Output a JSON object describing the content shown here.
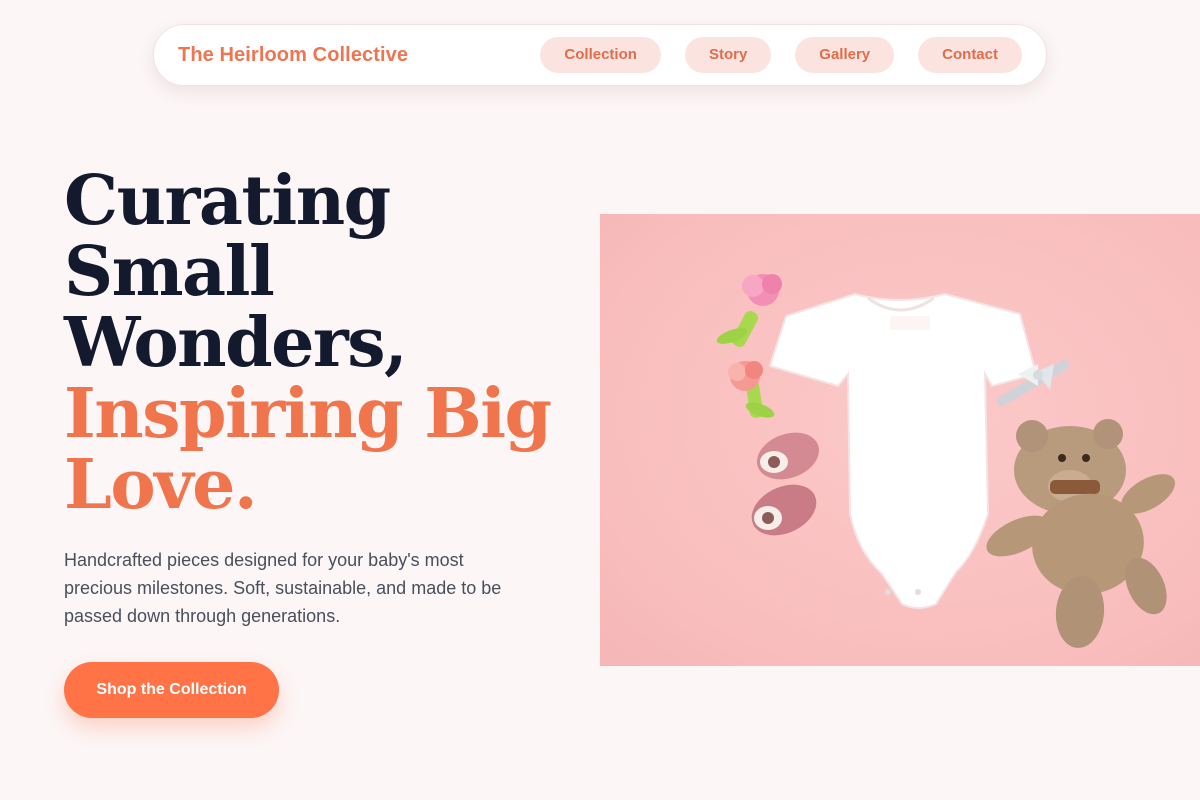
{
  "nav": {
    "brand": "The Heirloom Collective",
    "links": [
      {
        "label": "Collection"
      },
      {
        "label": "Story"
      },
      {
        "label": "Gallery"
      },
      {
        "label": "Contact"
      }
    ]
  },
  "hero": {
    "headline_lines_dark": [
      "Curating",
      "Small",
      "Wonders,"
    ],
    "headline_lines_accent": [
      "Inspiring Big",
      "Love."
    ],
    "subtext": "Handcrafted pieces designed for your baby's most precious milestones. Soft, sustainable, and made to be passed down through generations.",
    "cta_label": "Shop the Collection"
  },
  "colors": {
    "background": "#fcf6f6",
    "accent": "#f0744c",
    "cta": "#ff7347",
    "pill_bg": "#fbe4e0",
    "heading_dark": "#141a2e",
    "image_bg": "#f8bebd"
  }
}
